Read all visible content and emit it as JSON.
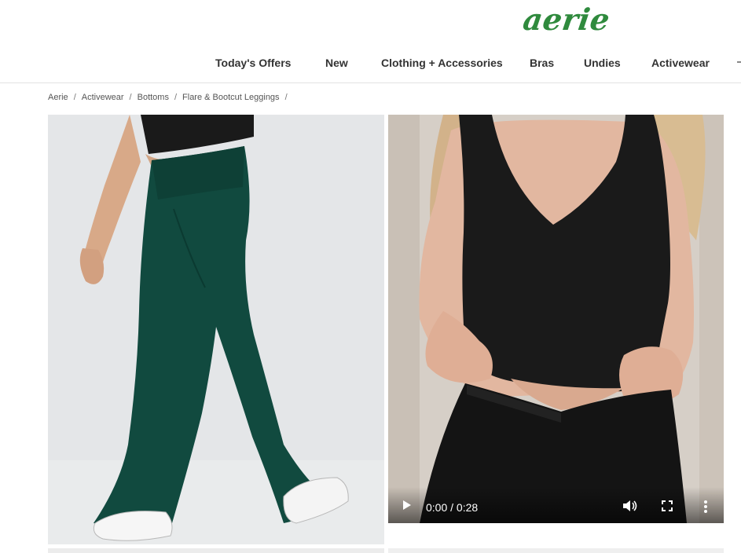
{
  "brand": {
    "logo_text": "aerie",
    "logo_color": "#2f8a3d"
  },
  "nav": {
    "items": [
      {
        "label": "Today's Offers"
      },
      {
        "label": "New"
      },
      {
        "label": "Clothing + Accessories"
      },
      {
        "label": "Bras"
      },
      {
        "label": "Undies"
      },
      {
        "label": "Activewear"
      }
    ]
  },
  "breadcrumb": {
    "items": [
      "Aerie",
      "Activewear",
      "Bottoms",
      "Flare & Bootcut Leggings"
    ],
    "separator": "/"
  },
  "gallery": {
    "image_1": {
      "subject": "dark green flare leggings"
    },
    "video": {
      "subject": "black top and black leggings",
      "time_display": "0:00 / 0:28",
      "current_time": "0:00",
      "duration": "0:28",
      "buffered_fraction": 0.85,
      "icons": [
        "play-icon",
        "volume-icon",
        "fullscreen-icon",
        "more-options-icon"
      ]
    }
  },
  "colors": {
    "accent": "#2f8a3d",
    "legging_green": "#114a3f",
    "top_black": "#1a1a1a"
  }
}
